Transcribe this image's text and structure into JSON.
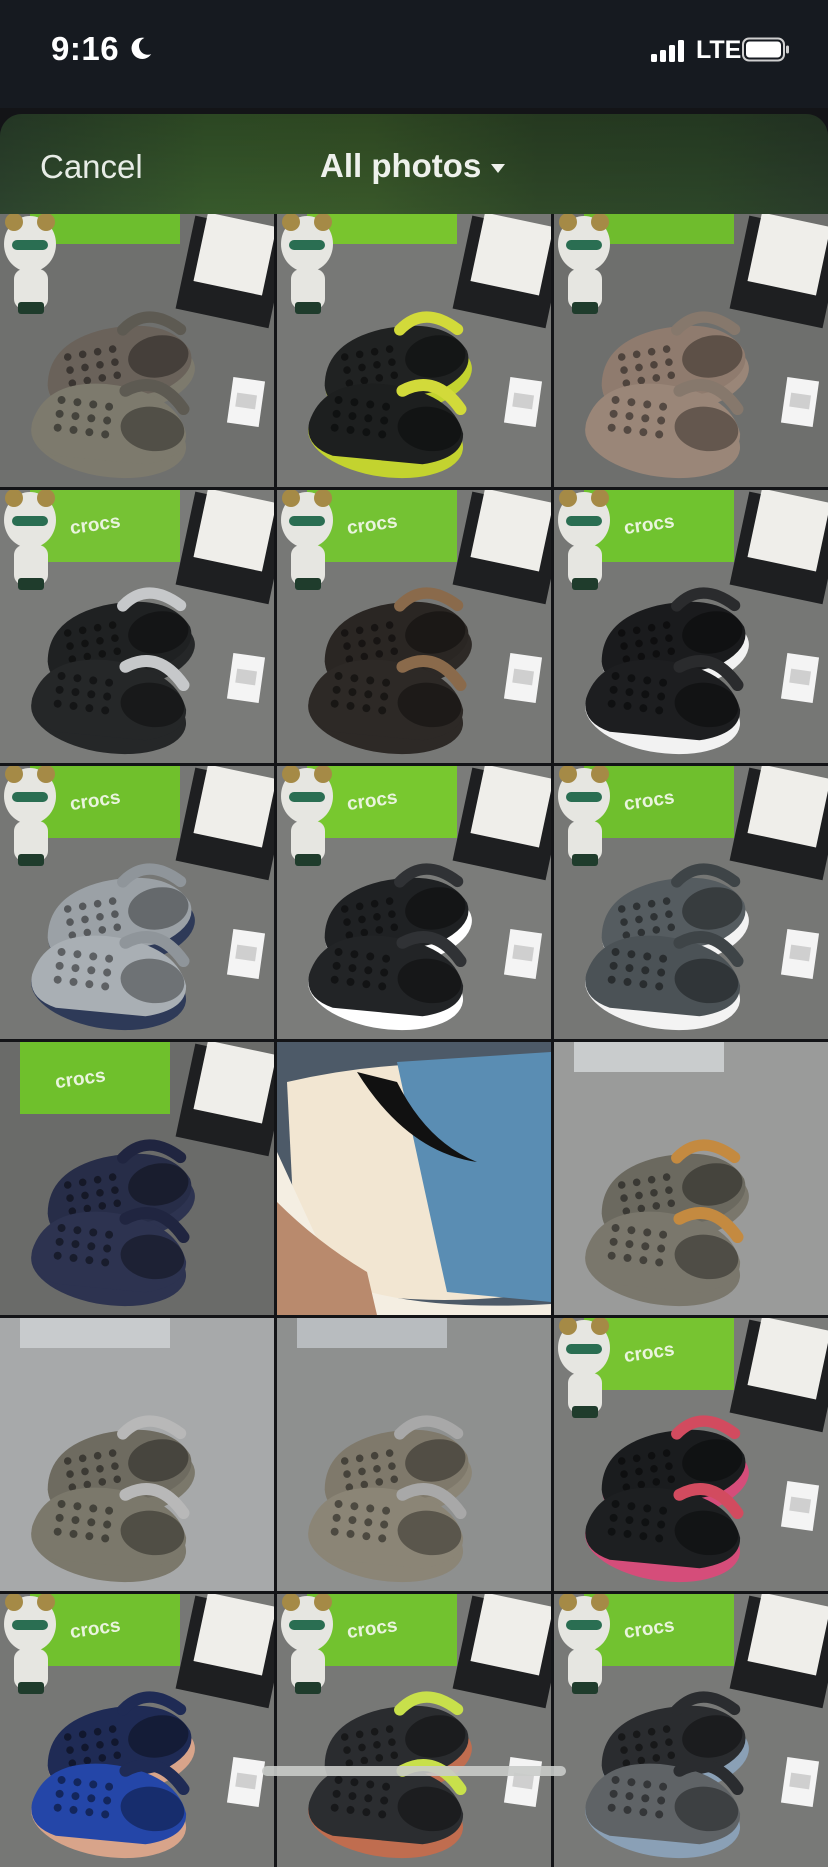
{
  "status_bar": {
    "time": "9:16",
    "network": "LTE",
    "icons": [
      "moon-icon",
      "signal-icon",
      "battery-icon"
    ]
  },
  "nav": {
    "cancel_label": "Cancel",
    "title": "All photos",
    "title_icon": "caret-down-icon"
  },
  "brand_text": "crocs",
  "photos": [
    {
      "kind": "clogs",
      "bg": "#6f706e",
      "box": "#6dbe2e",
      "shoe": "#7d7a6d",
      "shoe2": "#6a625a",
      "band": "#5d5a52",
      "sole": "#7d7a6d",
      "figure": true,
      "book": true,
      "tag": true
    },
    {
      "kind": "clogs",
      "bg": "#777876",
      "box": "#79c52e",
      "shoe": "#1d1f1f",
      "shoe2": "#202222",
      "band": "#d2da3a",
      "sole": "#c3d32f",
      "figure": true,
      "book": true,
      "tag": true
    },
    {
      "kind": "clogs",
      "bg": "#6e6f6d",
      "box": "#6fbc2d",
      "shoe": "#9a8678",
      "shoe2": "#8f7b6e",
      "band": "#86786c",
      "sole": "#9a8678",
      "figure": true,
      "book": true,
      "tag": true
    },
    {
      "kind": "clogs",
      "bg": "#7a7b79",
      "box": "#76c234",
      "shoe": "#252728",
      "shoe2": "#1f2122",
      "band": "#c6c8ca",
      "sole": "#252728",
      "figure": true,
      "book": true,
      "tag": true,
      "logo": true
    },
    {
      "kind": "clogs",
      "bg": "#777876",
      "box": "#74c233",
      "shoe": "#2d2926",
      "shoe2": "#2a2623",
      "band": "#8a6a4b",
      "sole": "#2d2926",
      "figure": true,
      "book": true,
      "tag": true,
      "logo": true
    },
    {
      "kind": "clogs",
      "bg": "#767775",
      "box": "#70c32f",
      "shoe": "#1d1e20",
      "shoe2": "#1a1b1d",
      "band": "#2a2b2d",
      "sole": "#f2f2f2",
      "figure": true,
      "book": true,
      "tag": true,
      "logo": true
    },
    {
      "kind": "clogs",
      "bg": "#767775",
      "box": "#70c02c",
      "shoe": "#a9afb4",
      "shoe2": "#9ba1a6",
      "band": "#8f959a",
      "sole": "#2e3a58",
      "figure": true,
      "book": true,
      "tag": true,
      "logo": true
    },
    {
      "kind": "clogs",
      "bg": "#7b7c7a",
      "box": "#78c82f",
      "shoe": "#222426",
      "shoe2": "#1f2123",
      "band": "#303235",
      "sole": "#ffffff",
      "figure": true,
      "book": true,
      "tag": true,
      "logo": true
    },
    {
      "kind": "clogs",
      "bg": "#767775",
      "box": "#6fbf2d",
      "shoe": "#4b5256",
      "shoe2": "#555c60",
      "band": "#3e4447",
      "sole": "#f3f3f3",
      "figure": true,
      "book": true,
      "tag": true,
      "logo": true
    },
    {
      "kind": "clogs",
      "bg": "#6a6b69",
      "box": "#6fc02c",
      "shoe": "#2d3350",
      "shoe2": "#272d48",
      "band": "#202540",
      "sole": "#2d3350",
      "figure": false,
      "book": true,
      "tag": false,
      "logo": true
    },
    {
      "kind": "sneaker",
      "bg": "#5b6978",
      "box": "#4d5a68",
      "shoe": "#5a8db3",
      "shoe2": "#f2e6d2",
      "band": "#111111",
      "sole": "#f4eee2",
      "figure": false,
      "book": false,
      "tag": false
    },
    {
      "kind": "clogs",
      "bg": "#9a9b9a",
      "box": "#c9cccd",
      "shoe": "#7a776c",
      "shoe2": "#6b695f",
      "band": "#c48a40",
      "sole": "#7a776c",
      "figure": false,
      "book": false,
      "tag": false
    },
    {
      "kind": "clogs",
      "bg": "#a7a9aa",
      "box": "#c8cbcd",
      "shoe": "#7b786b",
      "shoe2": "#6e6b60",
      "band": "#b8b8b8",
      "sole": "#7b786b",
      "figure": false,
      "book": false,
      "tag": false
    },
    {
      "kind": "clogs",
      "bg": "#8e908f",
      "box": "#b8bcbf",
      "shoe": "#8b8576",
      "shoe2": "#7f796b",
      "band": "#a8a8a8",
      "sole": "#8b8576",
      "figure": false,
      "book": false,
      "tag": false
    },
    {
      "kind": "clogs",
      "bg": "#7a7b79",
      "box": "#77c431",
      "shoe": "#1d1f21",
      "shoe2": "#1a1c1e",
      "band": "#d24b5f",
      "sole": "#d54d7a",
      "figure": true,
      "book": true,
      "tag": true,
      "logo": true
    },
    {
      "kind": "clogs",
      "bg": "#767775",
      "box": "#71c12e",
      "shoe": "#2446a8",
      "shoe2": "#1f2b55",
      "band": "#1f2b55",
      "sole": "#d8a48a",
      "figure": true,
      "book": true,
      "tag": true,
      "logo": true
    },
    {
      "kind": "clogs",
      "bg": "#777876",
      "box": "#72c22f",
      "shoe": "#2b2d30",
      "shoe2": "#2a2c2f",
      "band": "#c8e04b",
      "sole": "#c06d4f",
      "figure": true,
      "book": true,
      "tag": true,
      "logo": true
    },
    {
      "kind": "clogs",
      "bg": "#787977",
      "box": "#72c230",
      "shoe": "#5f6366",
      "shoe2": "#2a2c2f",
      "band": "#2a2c2f",
      "sole": "#8aa0b6",
      "figure": true,
      "book": true,
      "tag": true,
      "logo": true
    }
  ]
}
